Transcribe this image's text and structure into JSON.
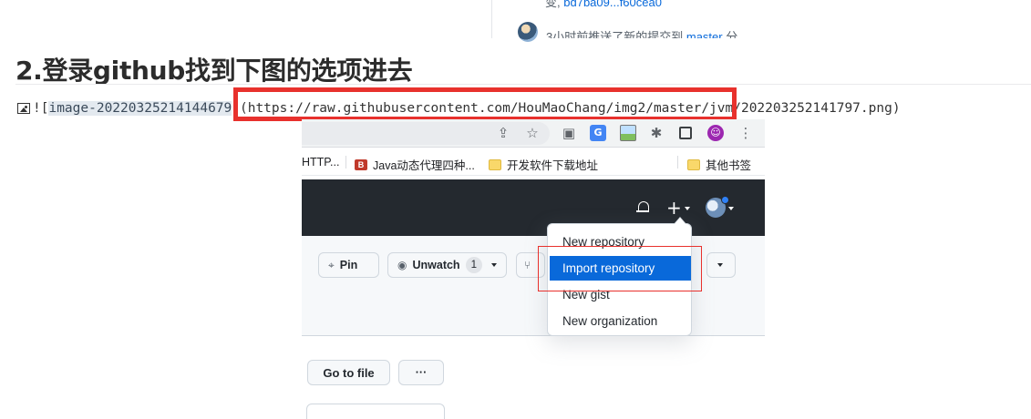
{
  "top_strip": {
    "clipped_commit_prefix": "变,",
    "clipped_commit_sha": "bd7ba09...f60cea0",
    "push_text": "3小时前推送了新的提交到",
    "push_branch": "master",
    "push_suffix": "分"
  },
  "heading": "2.登录github找到下图的选项进去",
  "markdown_line": {
    "prefix": "![",
    "alt_text": "image-20220325214144679",
    "middle": "](https://raw.githubusercontent.com/HouMaoChang/img2/master/jvm/",
    "suffix": "202203252141797.png)"
  },
  "screenshot": {
    "bookmarks": [
      {
        "label": "HTTP..."
      },
      {
        "label": "Java动态代理四种..."
      },
      {
        "label": "开发软件下载地址"
      },
      {
        "label": "其他书签"
      }
    ],
    "buttons": {
      "pin": "Pin",
      "unwatch": "Unwatch",
      "unwatch_count": "1",
      "go_to_file": "Go to file",
      "more": "···"
    },
    "menu": [
      {
        "label": "New repository"
      },
      {
        "label": "Import repository"
      },
      {
        "label": "New gist"
      },
      {
        "label": "New organization"
      }
    ],
    "colors": {
      "highlight_red": "#e8312d",
      "github_header": "#24292f",
      "menu_active": "#0969da"
    }
  }
}
